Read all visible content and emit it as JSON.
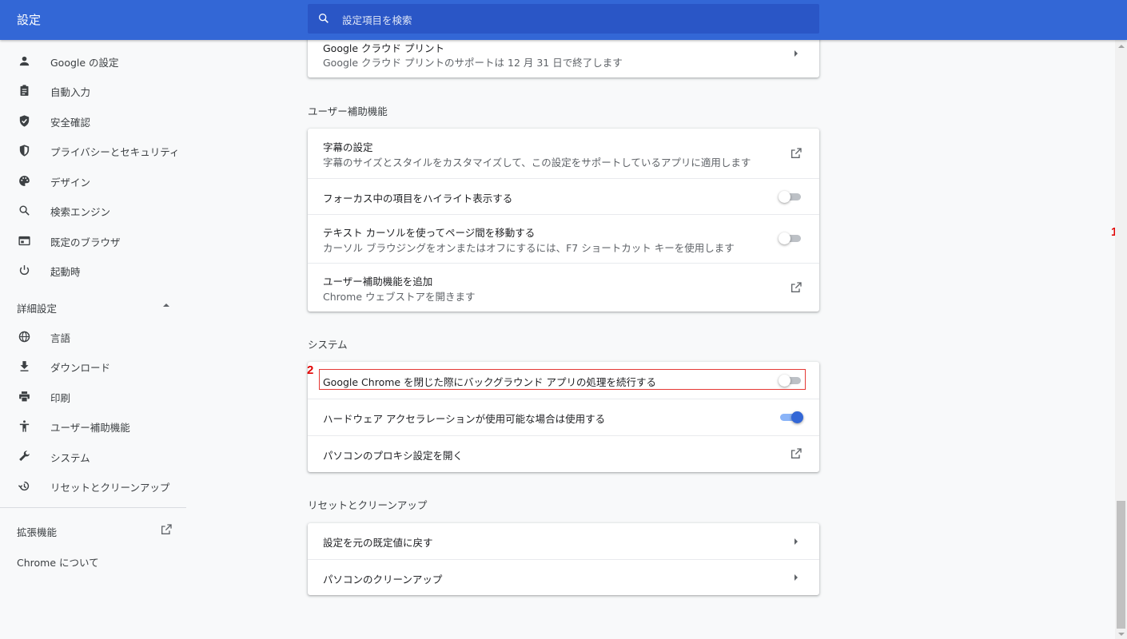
{
  "header": {
    "title": "設定",
    "search_placeholder": "設定項目を検索"
  },
  "sidebar": {
    "items": [
      {
        "label": "Google の設定",
        "icon": "person-icon"
      },
      {
        "label": "自動入力",
        "icon": "clipboard-icon"
      },
      {
        "label": "安全確認",
        "icon": "shield-check-icon"
      },
      {
        "label": "プライバシーとセキュリティ",
        "icon": "shield-icon"
      },
      {
        "label": "デザイン",
        "icon": "palette-icon"
      },
      {
        "label": "検索エンジン",
        "icon": "search-icon"
      },
      {
        "label": "既定のブラウザ",
        "icon": "browser-icon"
      },
      {
        "label": "起動時",
        "icon": "power-icon"
      }
    ],
    "advanced_label": "詳細設定",
    "advanced_items": [
      {
        "label": "言語",
        "icon": "globe-icon"
      },
      {
        "label": "ダウンロード",
        "icon": "download-icon"
      },
      {
        "label": "印刷",
        "icon": "printer-icon"
      },
      {
        "label": "ユーザー補助機能",
        "icon": "accessibility-icon"
      },
      {
        "label": "システム",
        "icon": "wrench-icon"
      },
      {
        "label": "リセットとクリーンアップ",
        "icon": "history-icon"
      }
    ],
    "extensions_label": "拡張機能",
    "about_label": "Chrome について"
  },
  "main": {
    "cloud_print": {
      "title": "Google クラウド プリント",
      "subtitle": "Google クラウド プリントのサポートは 12 月 31 日で終了します"
    },
    "accessibility": {
      "heading": "ユーザー補助機能",
      "rows": [
        {
          "title": "字幕の設定",
          "subtitle": "字幕のサイズとスタイルをカスタマイズして、この設定をサポートしているアプリに適用します",
          "control": "external-link"
        },
        {
          "title": "フォーカス中の項目をハイライト表示する",
          "control": "toggle",
          "on": false
        },
        {
          "title": "テキスト カーソルを使ってページ間を移動する",
          "subtitle": "カーソル ブラウジングをオンまたはオフにするには、F7 ショートカット キーを使用します",
          "control": "toggle",
          "on": false
        },
        {
          "title": "ユーザー補助機能を追加",
          "subtitle": "Chrome ウェブストアを開きます",
          "control": "external-link"
        }
      ]
    },
    "system": {
      "heading": "システム",
      "rows": [
        {
          "title": "Google Chrome を閉じた際にバックグラウンド アプリの処理を続行する",
          "control": "toggle",
          "on": false
        },
        {
          "title": "ハードウェア アクセラレーションが使用可能な場合は使用する",
          "control": "toggle",
          "on": true
        },
        {
          "title": "パソコンのプロキシ設定を開く",
          "control": "external-link"
        }
      ]
    },
    "reset": {
      "heading": "リセットとクリーンアップ",
      "rows": [
        {
          "title": "設定を元の既定値に戻す",
          "control": "arrow"
        },
        {
          "title": "パソコンのクリーンアップ",
          "control": "arrow"
        }
      ]
    }
  },
  "annotations": {
    "step1": "1",
    "step2": "2",
    "color": "#e00000"
  },
  "colors": {
    "header_bg": "#3367d6",
    "toggle_on": "#3367d6"
  }
}
